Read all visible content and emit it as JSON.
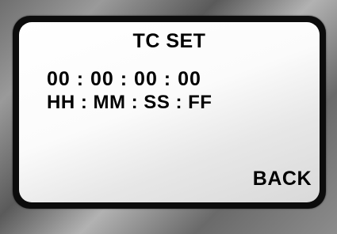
{
  "screen": {
    "title": "TC SET",
    "timecode_value": "00 : 00 : 00 : 00",
    "timecode_format": "HH : MM : SS : FF",
    "back_label": "BACK"
  }
}
